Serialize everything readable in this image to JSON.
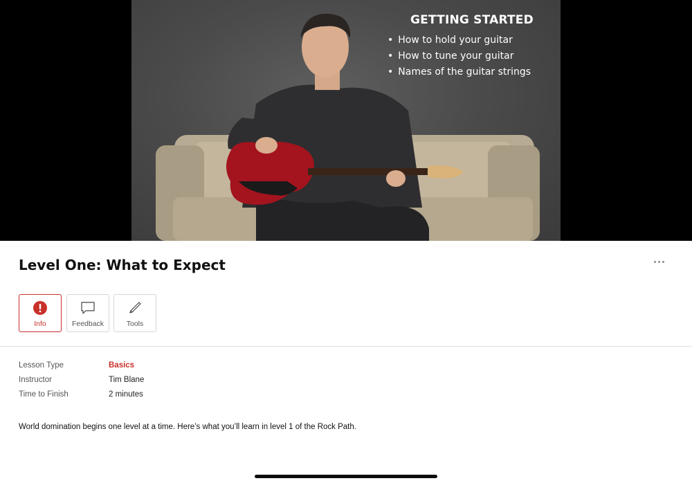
{
  "video": {
    "overlay_title": "GETTING STARTED",
    "overlay_items": [
      "How to hold your guitar",
      "How to tune your guitar",
      "Names of the guitar strings"
    ]
  },
  "lesson": {
    "title": "Level One: What to Expect"
  },
  "tabs": [
    {
      "label": "Info",
      "icon": "info-icon",
      "active": true
    },
    {
      "label": "Feedback",
      "icon": "speech-bubble-icon",
      "active": false
    },
    {
      "label": "Tools",
      "icon": "pencil-icon",
      "active": false
    }
  ],
  "details": [
    {
      "key": "Lesson Type",
      "value": "Basics"
    },
    {
      "key": "Instructor",
      "value": "Tim Blane"
    },
    {
      "key": "Time to Finish",
      "value": "2 minutes"
    }
  ],
  "description": "World domination begins one level at a time. Here’s what you’ll learn in level 1 of the Rock Path.",
  "colors": {
    "accent": "#c8302a",
    "video_background": "#000000",
    "studio_backdrop": "#4b4b4b"
  }
}
